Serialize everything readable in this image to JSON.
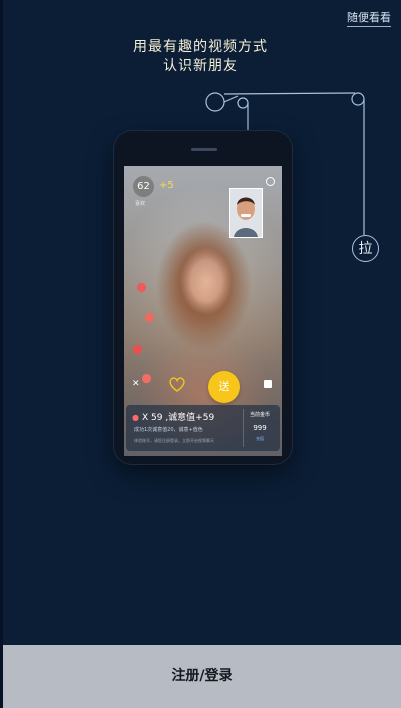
{
  "header": {
    "skip_label": "随便看看"
  },
  "headline": {
    "line1": "用最有趣的视频方式",
    "line2": "认识新朋友"
  },
  "pull_handle": {
    "label": "拉"
  },
  "preview": {
    "viewer_count": "62",
    "viewer_plus": "+5",
    "viewer_caption": "喜欢",
    "close_label": "✕",
    "gift_button_label": "送",
    "gift_count_text": "X 59 ,诚意值+59",
    "sincerity_note": "成功1次诚意值20，诚意+值色",
    "footer_note": "体验账号，请您注册登录，立即开启视频聊天",
    "balance_label": "当前金币",
    "balance_value": "999",
    "balance_action": "充值"
  },
  "footer": {
    "login_label": "注册/登录"
  },
  "colors": {
    "background": "#0b1e36",
    "accent": "#f8c51a",
    "login_bar": "#b7bcc4"
  }
}
